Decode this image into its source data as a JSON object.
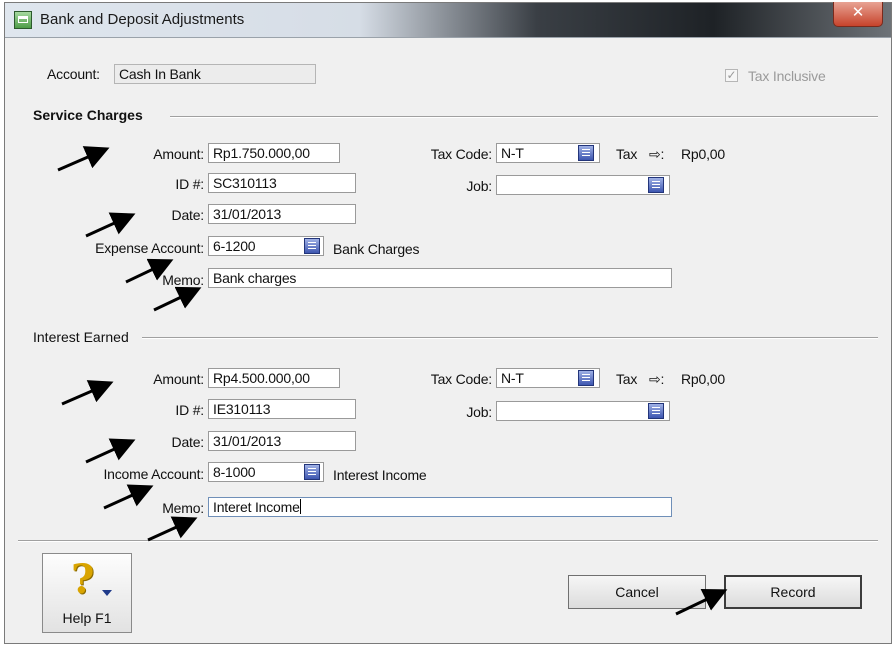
{
  "window": {
    "title": "Bank and Deposit Adjustments",
    "close_glyph": "✕"
  },
  "account": {
    "label": "Account:",
    "value": "Cash In Bank"
  },
  "tax_inclusive": {
    "label": "Tax Inclusive",
    "checked": true,
    "check_glyph": "✓"
  },
  "service_charges": {
    "heading": "Service Charges",
    "amount_label": "Amount:",
    "amount": "Rp1.750.000,00",
    "tax_code_label": "Tax Code:",
    "tax_code": "N-T",
    "tax_label": "Tax",
    "tax_arrow": "⇨:",
    "tax_value": "Rp0,00",
    "id_label": "ID #:",
    "id": "SC310113",
    "job_label": "Job:",
    "job": "",
    "date_label": "Date:",
    "date": "31/01/2013",
    "account_label": "Expense Account:",
    "account_no": "6-1200",
    "account_name": "Bank Charges",
    "memo_label": "Memo:",
    "memo": "Bank charges"
  },
  "interest_earned": {
    "heading": "Interest Earned",
    "amount_label": "Amount:",
    "amount": "Rp4.500.000,00",
    "tax_code_label": "Tax Code:",
    "tax_code": "N-T",
    "tax_label": "Tax",
    "tax_arrow": "⇨:",
    "tax_value": "Rp0,00",
    "id_label": "ID #:",
    "id": "IE310113",
    "job_label": "Job:",
    "job": "",
    "date_label": "Date:",
    "date": "31/01/2013",
    "account_label": "Income Account:",
    "account_no": "8-1000",
    "account_name": "Interest Income",
    "memo_label": "Memo:",
    "memo": "Interet Income"
  },
  "buttons": {
    "help": "Help F1",
    "help_glyph": "?",
    "cancel": "Cancel",
    "record": "Record"
  },
  "colors": {
    "arrow": "#000000",
    "lookup": "#3d56b0",
    "close": "#c7432b"
  }
}
